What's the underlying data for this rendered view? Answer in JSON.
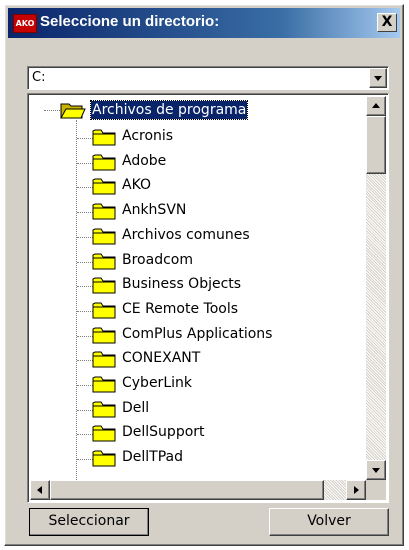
{
  "window": {
    "title": "Seleccione un directorio:",
    "icon_text": "AKO",
    "close_label": "X"
  },
  "drive": {
    "value": "C:"
  },
  "tree": {
    "root_label": "Archivos de programa",
    "items": [
      {
        "label": "Acronis"
      },
      {
        "label": "Adobe"
      },
      {
        "label": "AKO"
      },
      {
        "label": "AnkhSVN"
      },
      {
        "label": "Archivos comunes"
      },
      {
        "label": "Broadcom"
      },
      {
        "label": "Business Objects"
      },
      {
        "label": "CE Remote Tools"
      },
      {
        "label": "ComPlus Applications"
      },
      {
        "label": "CONEXANT"
      },
      {
        "label": "CyberLink"
      },
      {
        "label": "Dell"
      },
      {
        "label": "DellSupport"
      },
      {
        "label": "DellTPad"
      }
    ]
  },
  "buttons": {
    "select_label": "Seleccionar",
    "back_label": "Volver"
  },
  "colors": {
    "title_bar": "#0a246a",
    "selection": "#0a246a",
    "folder_fill": "#ffff00",
    "dialog_face": "#d4d0c8"
  }
}
